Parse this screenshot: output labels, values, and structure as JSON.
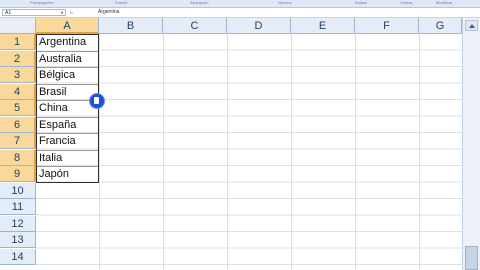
{
  "ribbon": {
    "groups": [
      "Portapapeles",
      "Fuente",
      "Alineación",
      "Número",
      "Estilos",
      "Celdas",
      "Modificar"
    ]
  },
  "formula_bar": {
    "name_box": "A1",
    "content": "Argentina"
  },
  "columns": [
    "A",
    "B",
    "C",
    "D",
    "E",
    "F",
    "G"
  ],
  "rows": [
    "1",
    "2",
    "3",
    "4",
    "5",
    "6",
    "7",
    "8",
    "9",
    "10",
    "11",
    "12",
    "13",
    "14"
  ],
  "cells": {
    "A": [
      "Argentina",
      "Australia",
      "Bélgica",
      "Brasil",
      "China",
      "España",
      "Francia",
      "Italia",
      "Japón"
    ]
  },
  "colors": {
    "selected_header": "#f9d99b",
    "header": "#e4ecf7",
    "cursor": "#1f4fd6"
  }
}
